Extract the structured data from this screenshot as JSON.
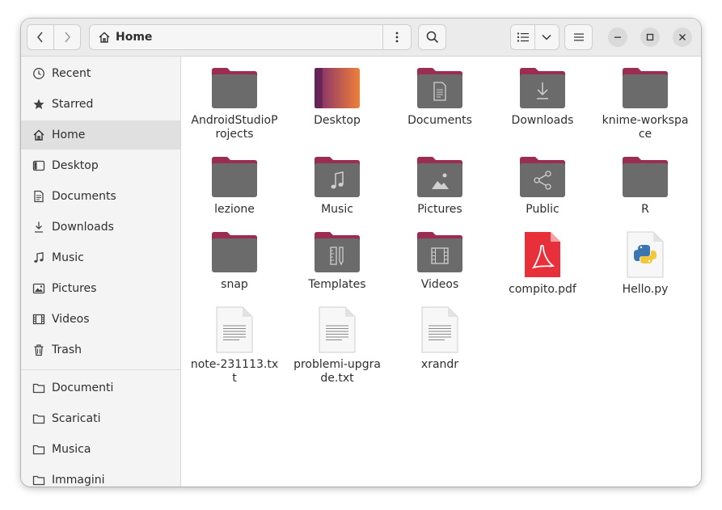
{
  "header": {
    "location": "Home",
    "icons": {
      "back": "chevron-left-icon",
      "forward": "chevron-right-icon",
      "home": "home-icon",
      "path_menu": "vertical-dots-icon",
      "search": "search-icon",
      "list_view": "list-view-icon",
      "view_options": "chevron-down-icon",
      "main_menu": "hamburger-icon",
      "minimize": "minimize-icon",
      "maximize": "maximize-icon",
      "close": "close-icon"
    }
  },
  "sidebar": {
    "items": [
      {
        "label": "Recent",
        "icon": "clock-icon"
      },
      {
        "label": "Starred",
        "icon": "star-icon"
      },
      {
        "label": "Home",
        "icon": "home-icon",
        "active": true
      },
      {
        "label": "Desktop",
        "icon": "desktop-icon"
      },
      {
        "label": "Documents",
        "icon": "document-icon"
      },
      {
        "label": "Downloads",
        "icon": "download-icon"
      },
      {
        "label": "Music",
        "icon": "music-icon"
      },
      {
        "label": "Pictures",
        "icon": "picture-icon"
      },
      {
        "label": "Videos",
        "icon": "film-icon"
      },
      {
        "label": "Trash",
        "icon": "trash-icon"
      },
      {
        "label": "Documenti",
        "icon": "folder-icon"
      },
      {
        "label": "Scaricati",
        "icon": "folder-icon"
      },
      {
        "label": "Musica",
        "icon": "folder-icon"
      },
      {
        "label": "Immagini",
        "icon": "folder-icon"
      }
    ]
  },
  "files": [
    {
      "name": "AndroidStudioProjects",
      "kind": "folder"
    },
    {
      "name": "Desktop",
      "kind": "desktop"
    },
    {
      "name": "Documents",
      "kind": "folder-documents"
    },
    {
      "name": "Downloads",
      "kind": "folder-downloads"
    },
    {
      "name": "knime-workspace",
      "kind": "folder"
    },
    {
      "name": "lezione",
      "kind": "folder"
    },
    {
      "name": "Music",
      "kind": "folder-music"
    },
    {
      "name": "Pictures",
      "kind": "folder-pictures"
    },
    {
      "name": "Public",
      "kind": "folder-public"
    },
    {
      "name": "R",
      "kind": "folder"
    },
    {
      "name": "snap",
      "kind": "folder"
    },
    {
      "name": "Templates",
      "kind": "folder-templates"
    },
    {
      "name": "Videos",
      "kind": "folder-videos"
    },
    {
      "name": "compito.pdf",
      "kind": "pdf"
    },
    {
      "name": "Hello.py",
      "kind": "python"
    },
    {
      "name": "note-231113.txt",
      "kind": "text"
    },
    {
      "name": "problemi-upgrade.txt",
      "kind": "text"
    },
    {
      "name": "xrandr",
      "kind": "text"
    }
  ],
  "colors": {
    "folder_tab": "#9b2c52",
    "folder_body": "#6b6b6b",
    "desktop_from": "#7a2a6e",
    "desktop_to": "#f0803a",
    "pdf": "#e8303a"
  }
}
